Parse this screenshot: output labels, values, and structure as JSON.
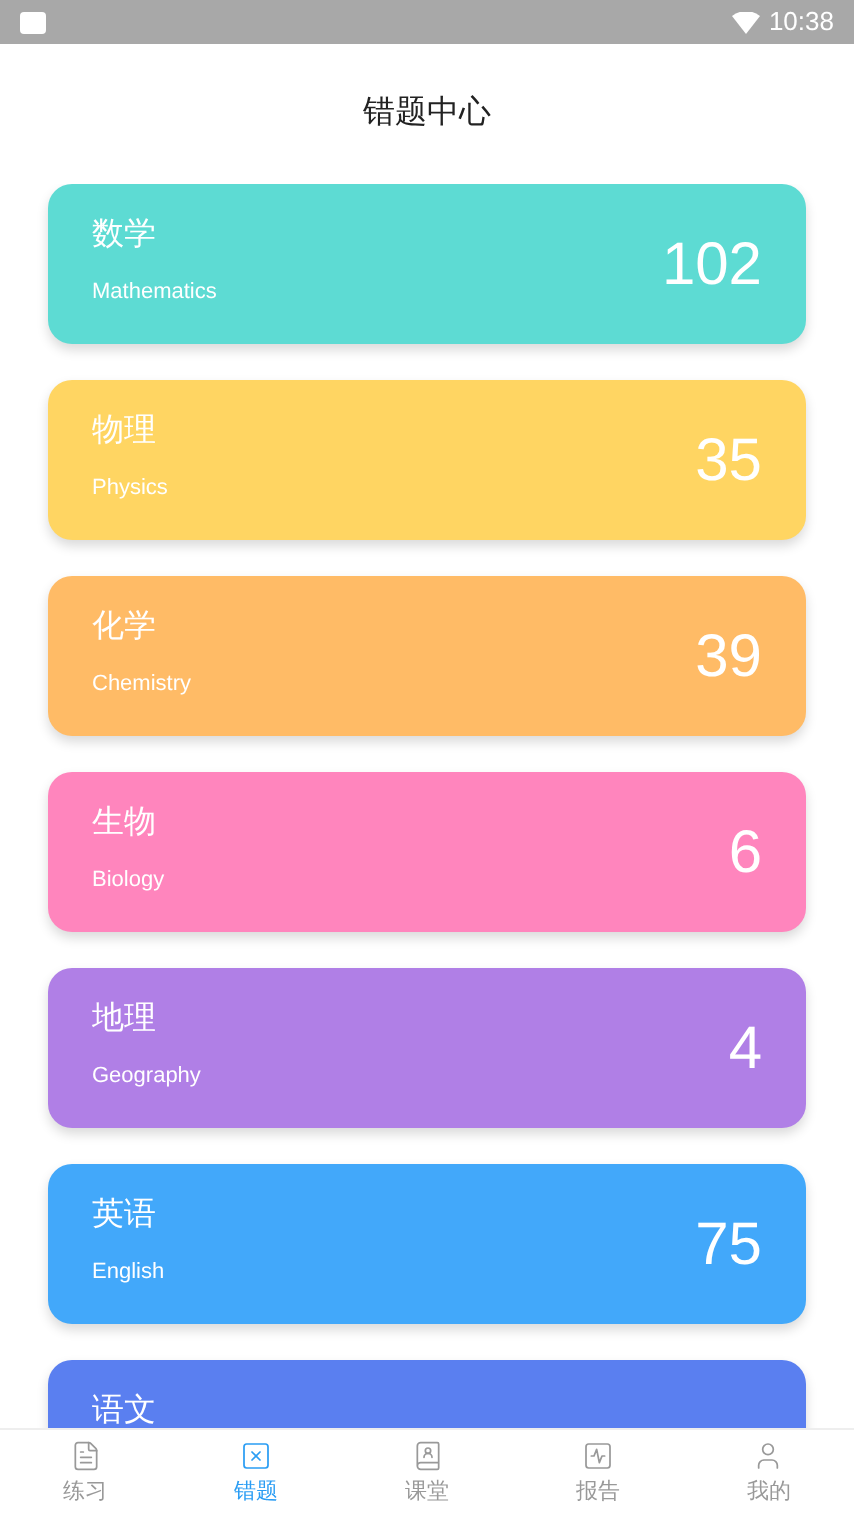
{
  "status_bar": {
    "time": "10:38"
  },
  "header": {
    "title": "错题中心"
  },
  "subjects": [
    {
      "name": "数学",
      "english": "Mathematics",
      "count": "102",
      "color": "#5ddbd3"
    },
    {
      "name": "物理",
      "english": "Physics",
      "count": "35",
      "color": "#ffd562"
    },
    {
      "name": "化学",
      "english": "Chemistry",
      "count": "39",
      "color": "#ffbb66"
    },
    {
      "name": "生物",
      "english": "Biology",
      "count": "6",
      "color": "#ff85bd"
    },
    {
      "name": "地理",
      "english": "Geography",
      "count": "4",
      "color": "#b07fe6"
    },
    {
      "name": "英语",
      "english": "English",
      "count": "75",
      "color": "#42a8fa"
    },
    {
      "name": "语文",
      "color": "#5a7ff0"
    }
  ],
  "tab_bar": [
    {
      "label": "练习",
      "kind": "practice",
      "selected": false
    },
    {
      "label": "错题",
      "kind": "mistakes",
      "selected": true
    },
    {
      "label": "课堂",
      "kind": "classroom",
      "selected": false
    },
    {
      "label": "报告",
      "kind": "report",
      "selected": false
    },
    {
      "label": "我的",
      "kind": "profile",
      "selected": false
    }
  ]
}
